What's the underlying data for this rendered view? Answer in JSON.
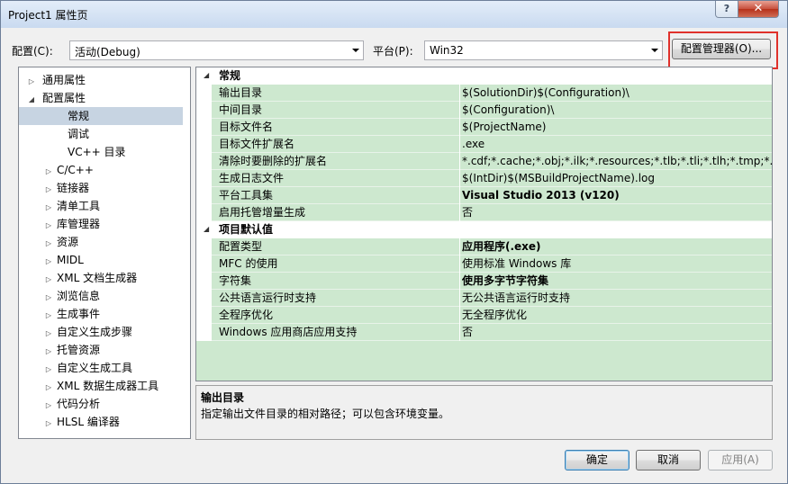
{
  "window": {
    "title": "Project1 属性页",
    "help_label": "?",
    "close_label": "✕"
  },
  "toolbar": {
    "config_label": "配置(C):",
    "config_value": "活动(Debug)",
    "platform_label": "平台(P):",
    "platform_value": "Win32",
    "config_manager_label": "配置管理器(O)..."
  },
  "tree": {
    "items": [
      {
        "label": "通用属性",
        "expander": "▷",
        "level": 0
      },
      {
        "label": "配置属性",
        "expander": "◢",
        "level": 0
      },
      {
        "label": "常规",
        "expander": "",
        "level": 1,
        "selected": true
      },
      {
        "label": "调试",
        "expander": "",
        "level": 1
      },
      {
        "label": "VC++ 目录",
        "expander": "",
        "level": 1
      },
      {
        "label": "C/C++",
        "expander": "▷",
        "level": 1
      },
      {
        "label": "链接器",
        "expander": "▷",
        "level": 1
      },
      {
        "label": "清单工具",
        "expander": "▷",
        "level": 1
      },
      {
        "label": "库管理器",
        "expander": "▷",
        "level": 1
      },
      {
        "label": "资源",
        "expander": "▷",
        "level": 1
      },
      {
        "label": "MIDL",
        "expander": "▷",
        "level": 1
      },
      {
        "label": "XML 文档生成器",
        "expander": "▷",
        "level": 1
      },
      {
        "label": "浏览信息",
        "expander": "▷",
        "level": 1
      },
      {
        "label": "生成事件",
        "expander": "▷",
        "level": 1
      },
      {
        "label": "自定义生成步骤",
        "expander": "▷",
        "level": 1
      },
      {
        "label": "托管资源",
        "expander": "▷",
        "level": 1
      },
      {
        "label": "自定义生成工具",
        "expander": "▷",
        "level": 1
      },
      {
        "label": "XML 数据生成器工具",
        "expander": "▷",
        "level": 1
      },
      {
        "label": "代码分析",
        "expander": "▷",
        "level": 1
      },
      {
        "label": "HLSL 编译器",
        "expander": "▷",
        "level": 1
      }
    ]
  },
  "grid": {
    "categories": [
      {
        "name": "常规",
        "arrow": "◢",
        "props": [
          {
            "name": "输出目录",
            "value": "$(SolutionDir)$(Configuration)\\",
            "bold": false
          },
          {
            "name": "中间目录",
            "value": "$(Configuration)\\",
            "bold": false
          },
          {
            "name": "目标文件名",
            "value": "$(ProjectName)",
            "bold": false
          },
          {
            "name": "目标文件扩展名",
            "value": ".exe",
            "bold": false
          },
          {
            "name": "清除时要删除的扩展名",
            "value": "*.cdf;*.cache;*.obj;*.ilk;*.resources;*.tlb;*.tli;*.tlh;*.tmp;*.rsp;*.p",
            "bold": false
          },
          {
            "name": "生成日志文件",
            "value": "$(IntDir)$(MSBuildProjectName).log",
            "bold": false
          },
          {
            "name": "平台工具集",
            "value": "Visual Studio 2013 (v120)",
            "bold": true
          },
          {
            "name": "启用托管增量生成",
            "value": "否",
            "bold": false
          }
        ]
      },
      {
        "name": "项目默认值",
        "arrow": "◢",
        "props": [
          {
            "name": "配置类型",
            "value": "应用程序(.exe)",
            "bold": true
          },
          {
            "name": "MFC 的使用",
            "value": "使用标准 Windows 库",
            "bold": false
          },
          {
            "name": "字符集",
            "value": "使用多字节字符集",
            "bold": true
          },
          {
            "name": "公共语言运行时支持",
            "value": "无公共语言运行时支持",
            "bold": false
          },
          {
            "name": "全程序优化",
            "value": "无全程序优化",
            "bold": false
          },
          {
            "name": "Windows 应用商店应用支持",
            "value": "否",
            "bold": false
          }
        ]
      }
    ]
  },
  "description": {
    "title": "输出目录",
    "text": "指定输出文件目录的相对路径；可以包含环境变量。"
  },
  "footer": {
    "ok_label": "确定",
    "cancel_label": "取消",
    "apply_label": "应用(A)"
  },
  "colors": {
    "grid_bg": "#cde8cf",
    "highlight_border": "#e0312b",
    "selected_tree_bg": "#c7d4e2"
  }
}
